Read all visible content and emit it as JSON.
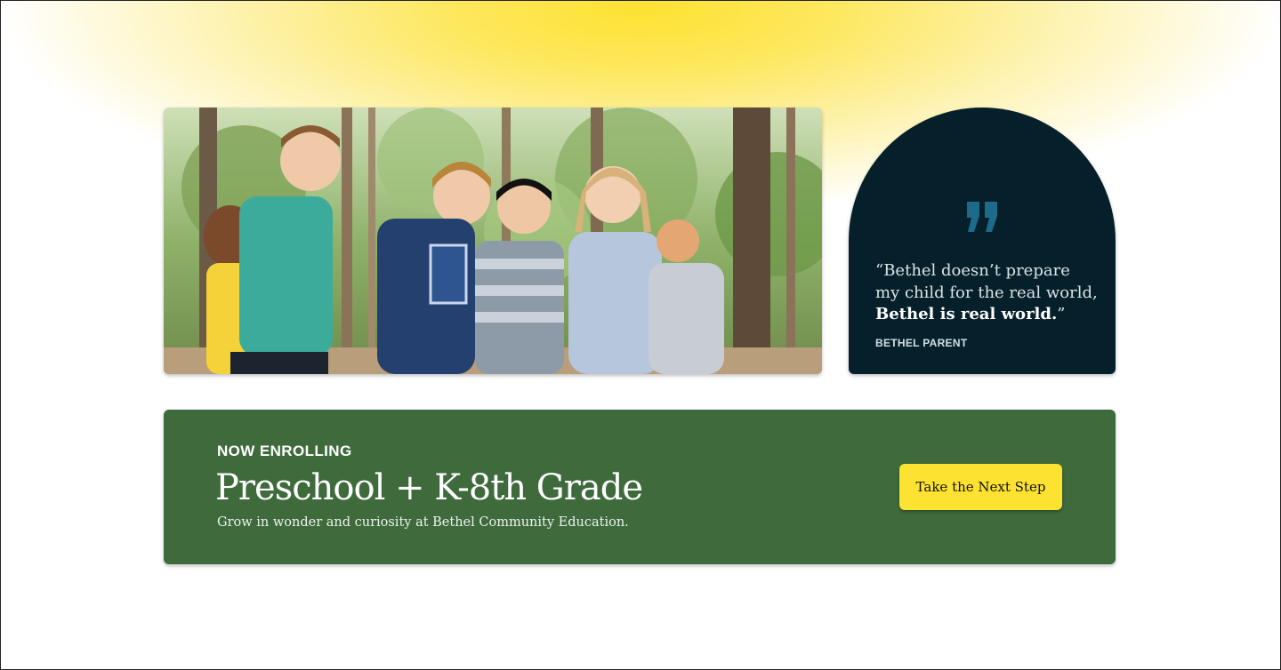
{
  "hero": {
    "photo_alt": "Children walking together in a sunny forest"
  },
  "testimonial": {
    "quote_icon": "quote-mark-icon",
    "line1": "“Bethel doesn’t prepare my child for the real world,",
    "line2": "Bethel is real world.",
    "line2_close": "”",
    "author": "BETHEL PARENT"
  },
  "enrollment": {
    "eyebrow": "NOW ENROLLING",
    "title": "Preschool + K-8th Grade",
    "subtitle": "Grow in wonder and curiosity at Bethel Community Education.",
    "cta_label": "Take the Next Step"
  },
  "colors": {
    "glow_yellow": "#fde232",
    "quote_bg": "#06202b",
    "quote_mark": "#1e6a8a",
    "enroll_green": "#3e6a3c",
    "cta_yellow": "#fde232"
  }
}
